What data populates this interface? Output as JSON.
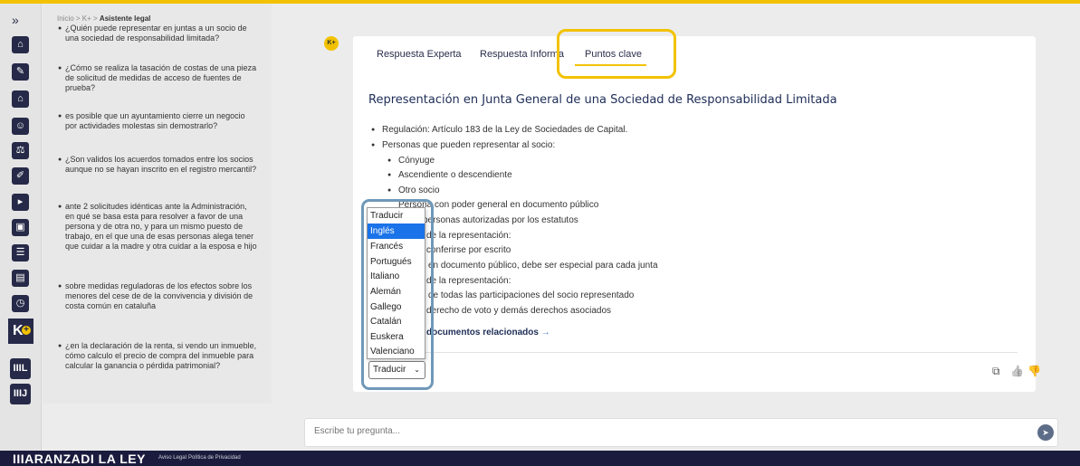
{
  "rail": {
    "collapse_glyph": "»",
    "icons": [
      "home-icon",
      "pen-icon",
      "building-icon",
      "people-icon",
      "scales-icon",
      "edit-icon",
      "play-icon",
      "book-icon",
      "list-icon",
      "document-icon",
      "clock-icon"
    ],
    "kplus_label": "K",
    "kplus_plus": "+",
    "btn1": "IIIL",
    "btn2": "IIIJ"
  },
  "breadcrumb": {
    "path": "Inicio > K+ > ",
    "current": "Asistente legal"
  },
  "history": [
    "¿Quién puede representar en juntas a un socio de una sociedad de responsabilidad limitada?",
    "¿Cómo se realiza la tasación de costas de una pieza de solicitud de medidas de acceso de fuentes de prueba?",
    "es posible que un ayuntamiento cierre un negocio por actividades molestas sin demostrarlo?",
    "¿Son validos los acuerdos tomados entre los socios aunque no se hayan inscrito en el registro mercantil?",
    "ante 2 solicitudes idénticas ante la Administración, en qué se basa esta para resolver a favor de una persona y de otra no, y para un mismo puesto de trabajo, en el que una de esas personas alega tener que cuidar a la madre y otra cuidar a la esposa e hijo",
    "sobre medidas reguladoras de los efectos sobre los menores del cese de de la convivencia y división de costa común en cataluña",
    "¿en la declaración de la renta, si vendo un inmueble, cómo calculo el precio de compra del inmueble para calcular la ganancia o pérdida patrimonial?"
  ],
  "badge": "K+",
  "tabs": {
    "experta": "Respuesta Experta",
    "informal": "Respuesta Informa",
    "clave": "Puntos clave"
  },
  "content": {
    "title": "Representación en Junta General de una Sociedad de Responsabilidad Limitada",
    "b1": "Regulación: Artículo 183 de la Ley de Sociedades de Capital.",
    "b2": "Personas que pueden representar al socio:",
    "s1": "Cónyuge",
    "s2": "Ascendiente o descendiente",
    "s3": "Otro socio",
    "s4": "Persona con poder general en documento público",
    "s5": "personas autorizadas por los estatutos",
    "b3": "de la representación:",
    "s6": "conferirse por escrito",
    "s7": "en documento público, debe ser especial para cada junta",
    "b4": "de la representación:",
    "s8": "de todas las participaciones del socio representado",
    "s9": "derecho de voto y demás derechos asociados",
    "docs": "documentos relacionados",
    "docs_arrow": "→"
  },
  "translate": {
    "selected": "Traducir",
    "options": [
      "Traducir",
      "Inglés",
      "Francés",
      "Portugués",
      "Italiano",
      "Alemán",
      "Gallego",
      "Catalán",
      "Euskera",
      "Valenciano"
    ],
    "highlighted": "Inglés"
  },
  "actions": {
    "copy": "⧉",
    "like": "👍",
    "dislike": "👎"
  },
  "input": {
    "placeholder": "Escribe tu pregunta..."
  },
  "footer": {
    "logo": "IIIARANZADI LA LEY",
    "link1": "Aviso Legal",
    "link2": "Política de Privacidad"
  },
  "colors": {
    "accent": "#f2c200",
    "navy": "#262a48",
    "dropdown_frame": "#6f98b8",
    "dislike": "#e05050"
  }
}
